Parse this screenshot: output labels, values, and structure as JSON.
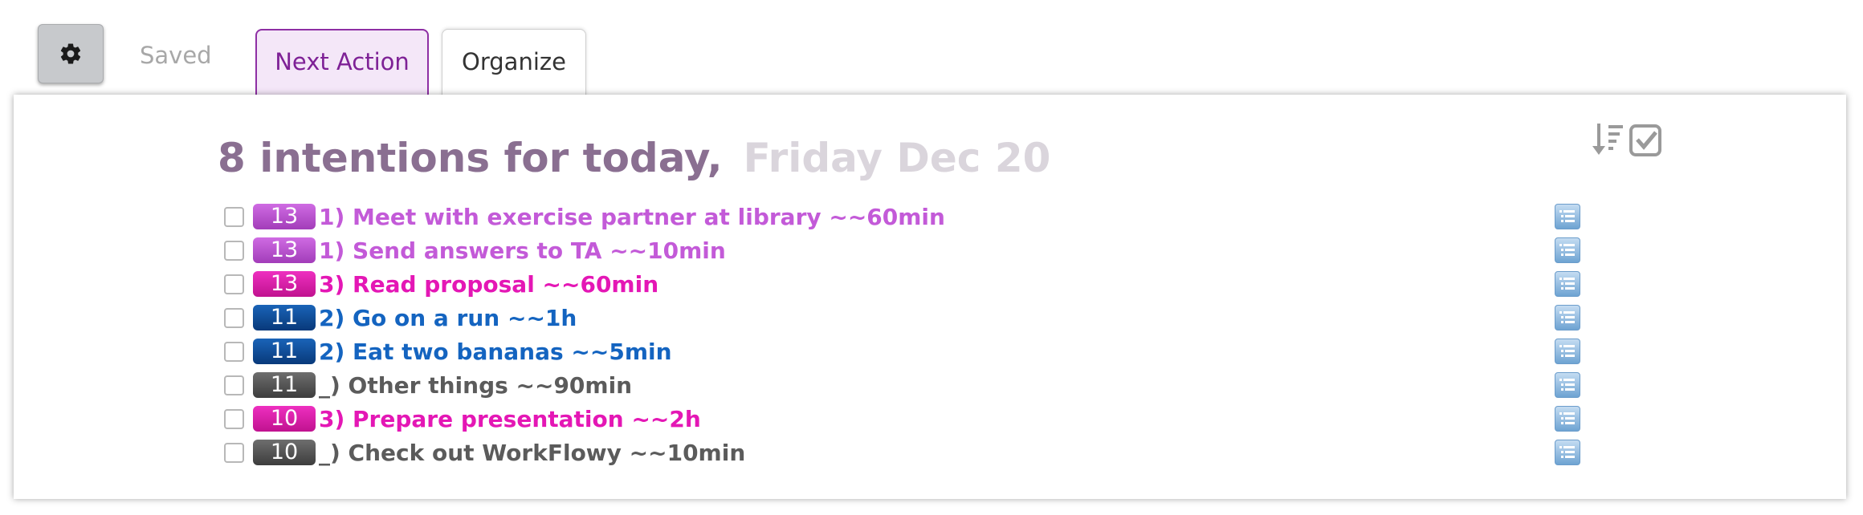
{
  "header": {
    "settings_icon": "gear-icon",
    "saved_label": "Saved",
    "tabs": [
      {
        "label": "Next Action",
        "active": true
      },
      {
        "label": "Organize",
        "active": false
      }
    ]
  },
  "main": {
    "heading_count": "8 intentions for today,",
    "heading_date": "Friday Dec 20",
    "tools": [
      "sort-icon",
      "check-all-icon"
    ]
  },
  "items": [
    {
      "score": "13",
      "text": "1) Meet with exercise partner at library ~~60min",
      "color": "purple",
      "checked": false
    },
    {
      "score": "13",
      "text": "1) Send answers to TA ~~10min",
      "color": "purple",
      "checked": false
    },
    {
      "score": "13",
      "text": "3) Read proposal ~~60min",
      "color": "magenta",
      "checked": false
    },
    {
      "score": "11",
      "text": "2) Go on a run ~~1h",
      "color": "blue",
      "checked": false
    },
    {
      "score": "11",
      "text": "2) Eat two bananas ~~5min",
      "color": "blue",
      "checked": false
    },
    {
      "score": "11",
      "text": "_) Other things ~~90min",
      "color": "dark",
      "checked": false
    },
    {
      "score": "10",
      "text": "3) Prepare presentation ~~2h",
      "color": "magenta",
      "checked": false
    },
    {
      "score": "10",
      "text": "_) Check out WorkFlowy ~~10min",
      "color": "dark",
      "checked": false
    }
  ],
  "colors": {
    "purple": "#c35ad8",
    "magenta": "#e417b5",
    "blue": "#1464c0",
    "dark": "#5b5b5b",
    "heading": "#8a6f91",
    "date": "#dad5dc"
  }
}
